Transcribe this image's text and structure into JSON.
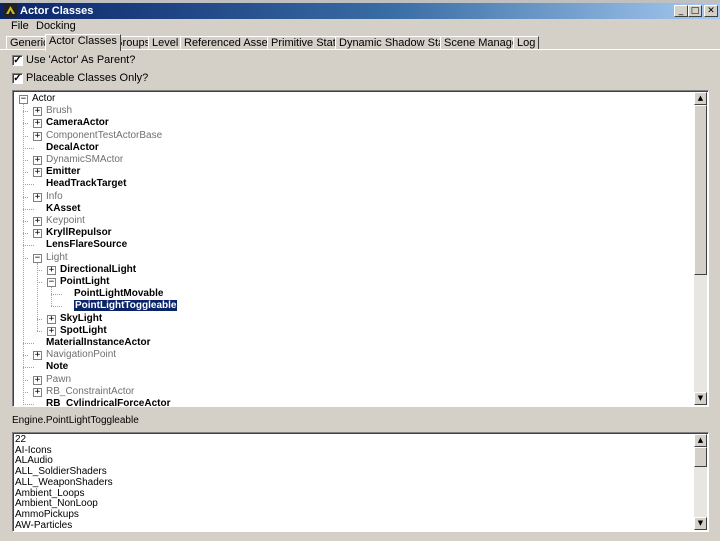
{
  "window": {
    "title": "Actor Classes",
    "minimize_glyph": "_",
    "maximize_glyph": "□",
    "close_glyph": "✕"
  },
  "menu": [
    {
      "label": "File"
    },
    {
      "label": "Docking"
    }
  ],
  "tabs": [
    {
      "label": "Generic"
    },
    {
      "label": "Actor Classes",
      "active": true
    },
    {
      "label": "Groups"
    },
    {
      "label": "Level"
    },
    {
      "label": "Referenced Assets"
    },
    {
      "label": "Primitive Stats"
    },
    {
      "label": "Dynamic Shadow Stats"
    },
    {
      "label": "Scene Manager"
    },
    {
      "label": "Log"
    }
  ],
  "options": {
    "use_actor_as_parent": {
      "label": "Use 'Actor' As Parent?",
      "checked": true
    },
    "placeable_only": {
      "label": "Placeable Classes Only?",
      "checked": true
    }
  },
  "tree": {
    "root": "Actor",
    "items": [
      {
        "label": "Brush",
        "level": 1,
        "expander": "+",
        "style": "gray"
      },
      {
        "label": "CameraActor",
        "level": 1,
        "expander": "+",
        "style": "bold"
      },
      {
        "label": "ComponentTestActorBase",
        "level": 1,
        "expander": "+",
        "style": "gray"
      },
      {
        "label": "DecalActor",
        "level": 1,
        "expander": "",
        "style": "bold"
      },
      {
        "label": "DynamicSMActor",
        "level": 1,
        "expander": "+",
        "style": "gray"
      },
      {
        "label": "Emitter",
        "level": 1,
        "expander": "+",
        "style": "bold"
      },
      {
        "label": "HeadTrackTarget",
        "level": 1,
        "expander": "",
        "style": "bold"
      },
      {
        "label": "Info",
        "level": 1,
        "expander": "+",
        "style": "gray"
      },
      {
        "label": "KAsset",
        "level": 1,
        "expander": "",
        "style": "bold"
      },
      {
        "label": "Keypoint",
        "level": 1,
        "expander": "+",
        "style": "gray"
      },
      {
        "label": "KryllRepulsor",
        "level": 1,
        "expander": "+",
        "style": "bold"
      },
      {
        "label": "LensFlareSource",
        "level": 1,
        "expander": "",
        "style": "bold"
      },
      {
        "label": "Light",
        "level": 1,
        "expander": "-",
        "style": "gray"
      },
      {
        "label": "DirectionalLight",
        "level": 2,
        "expander": "+",
        "style": "bold"
      },
      {
        "label": "PointLight",
        "level": 2,
        "expander": "-",
        "style": "bold"
      },
      {
        "label": "PointLightMovable",
        "level": 3,
        "expander": "",
        "style": "bold"
      },
      {
        "label": "PointLightToggleable",
        "level": 3,
        "expander": "",
        "style": "bold",
        "selected": true
      },
      {
        "label": "SkyLight",
        "level": 2,
        "expander": "+",
        "style": "bold"
      },
      {
        "label": "SpotLight",
        "level": 2,
        "expander": "+",
        "style": "bold"
      },
      {
        "label": "MaterialInstanceActor",
        "level": 1,
        "expander": "",
        "style": "bold"
      },
      {
        "label": "NavigationPoint",
        "level": 1,
        "expander": "+",
        "style": "gray"
      },
      {
        "label": "Note",
        "level": 1,
        "expander": "",
        "style": "bold"
      },
      {
        "label": "Pawn",
        "level": 1,
        "expander": "+",
        "style": "gray"
      },
      {
        "label": "RB_ConstraintActor",
        "level": 1,
        "expander": "+",
        "style": "gray"
      },
      {
        "label": "RB_CylindricalForceActor",
        "level": 1,
        "expander": "",
        "style": "bold"
      }
    ]
  },
  "selected_path": "Engine.PointLightToggleable",
  "packages": [
    "22",
    "AI-Icons",
    "ALAudio",
    "ALL_SoldierShaders",
    "ALL_WeaponShaders",
    "Ambient_Loops",
    "Ambient_NonLoop",
    "AmmoPickups",
    "AW-Particles"
  ],
  "scroll": {
    "up_glyph": "▲",
    "down_glyph": "▼"
  },
  "colors": {
    "selection": "#0a246a",
    "title_start": "#0a246a",
    "title_end": "#a6caf0",
    "panel": "#d4d0c8"
  }
}
